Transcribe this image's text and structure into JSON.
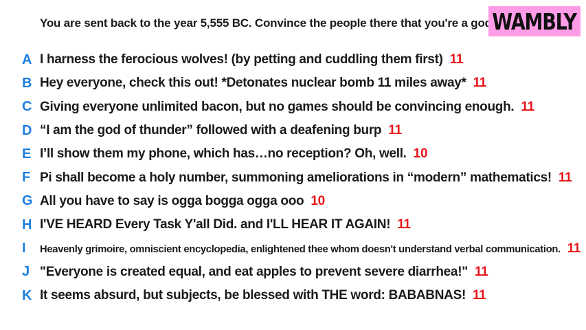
{
  "prompt": "You are sent back to the year 5,555 BC. Convince the people there that you're a god.",
  "logo": {
    "text": "WAMBLY",
    "bg_color": "#ff9ce8"
  },
  "colors": {
    "letter": "#1e7fe0",
    "score": "#e8141a",
    "text": "#1a1a1a"
  },
  "answers": [
    {
      "letter": "A",
      "text": "I harness the ferocious wolves! (by petting and cuddling them first)",
      "score": "11"
    },
    {
      "letter": "B",
      "text": "Hey everyone, check this out! *Detonates nuclear bomb 11 miles away*",
      "score": "11"
    },
    {
      "letter": "C",
      "text": "Giving everyone unlimited bacon, but no games should be convincing enough.",
      "score": "11"
    },
    {
      "letter": "D",
      "text": "“I am the god of thunder” followed with a deafening burp",
      "score": "11"
    },
    {
      "letter": "E",
      "text": "I’ll show them my phone, which has…no reception? Oh, well.",
      "score": "10"
    },
    {
      "letter": "F",
      "text": "Pi shall become a holy number, summoning ameliorations in “modern” mathematics!",
      "score": "11"
    },
    {
      "letter": "G",
      "text": "All you have to say is ogga bogga ogga ooo",
      "score": "10"
    },
    {
      "letter": "H",
      "text": "I'VE HEARD Every Task Y'all Did. and I'LL HEAR IT AGAIN!",
      "score": "11"
    },
    {
      "letter": "I",
      "text": "Heavenly grimoire, omniscient encyclopedia, enlightened thee whom doesn't understand verbal communication.",
      "score": "11"
    },
    {
      "letter": "J",
      "text": "\"Everyone is created equal, and eat apples to prevent severe diarrhea!\"",
      "score": "11"
    },
    {
      "letter": "K",
      "text": "It seems absurd, but subjects, be blessed with THE word: BABABNAS!",
      "score": "11"
    }
  ]
}
